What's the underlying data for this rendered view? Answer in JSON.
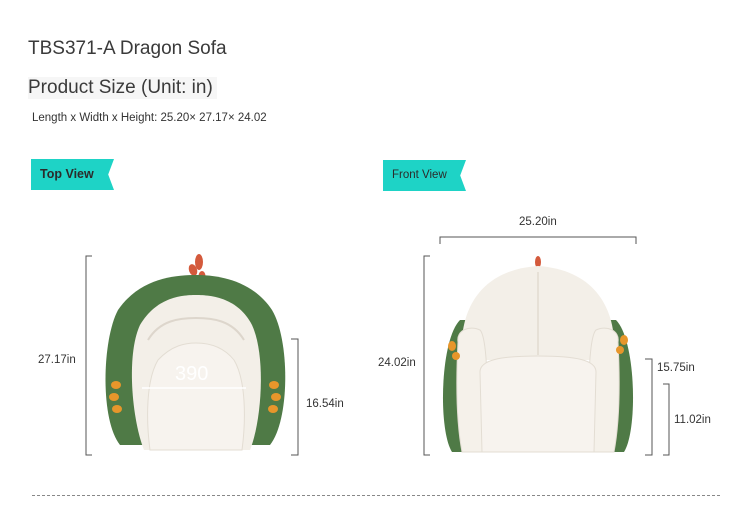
{
  "product": {
    "title": "TBS371-A Dragon Sofa",
    "size_heading": "Product Size (Unit: in)",
    "dimensions_text": "Length x Width x Height: 25.20× 27.17× 24.02"
  },
  "top_view": {
    "tag": "Top View",
    "depth_label": "27.17in",
    "seat_depth_label": "16.54in",
    "seat_measure": "390"
  },
  "front_view": {
    "tag": "Front View",
    "width_label": "25.20in",
    "height_label": "24.02in",
    "arm_height_label": "15.75in",
    "seat_height_label": "11.02in"
  },
  "colors": {
    "accent_tag": "#1ed3c6",
    "sofa_green": "#4f7a46",
    "sofa_cream": "#f3efe8",
    "spike_red": "#d45a3c",
    "claw_orange": "#e7962b"
  }
}
